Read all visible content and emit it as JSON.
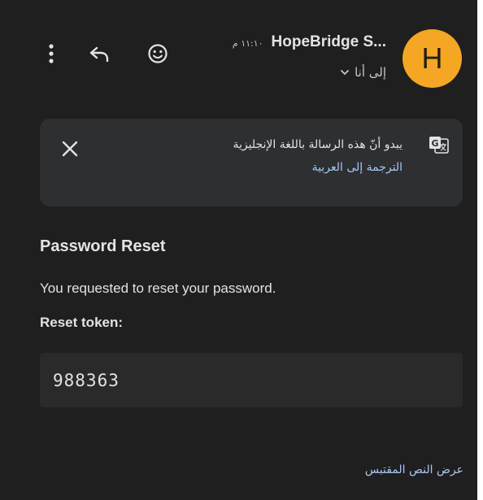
{
  "header": {
    "avatar_letter": "H",
    "avatar_color": "#f5a623",
    "sender_name": "HopeBridge S...",
    "time": "١١:١٠ م",
    "recipient": "إلى أنا"
  },
  "icons": {
    "more": "more-vert-icon",
    "reply": "reply-icon",
    "emoji": "emoji-icon",
    "chevron": "chevron-down-icon",
    "translate": "translate-icon",
    "close": "close-icon"
  },
  "translate_banner": {
    "message": "يبدو أنّ هذه الرسالة باللغة الإنجليزية",
    "link": "الترجمة إلى العربية"
  },
  "email": {
    "title": "Password Reset",
    "line1": "You requested to reset your password.",
    "token_label": "Reset token:",
    "token": "988363"
  },
  "footer": {
    "show_quoted": "عرض النص المقتبس"
  },
  "colors": {
    "background": "#1f1f1f",
    "banner": "#2d2f31",
    "token_box": "#2a2a2a",
    "link": "#a8c7fa",
    "text": "#e3e3e3"
  }
}
